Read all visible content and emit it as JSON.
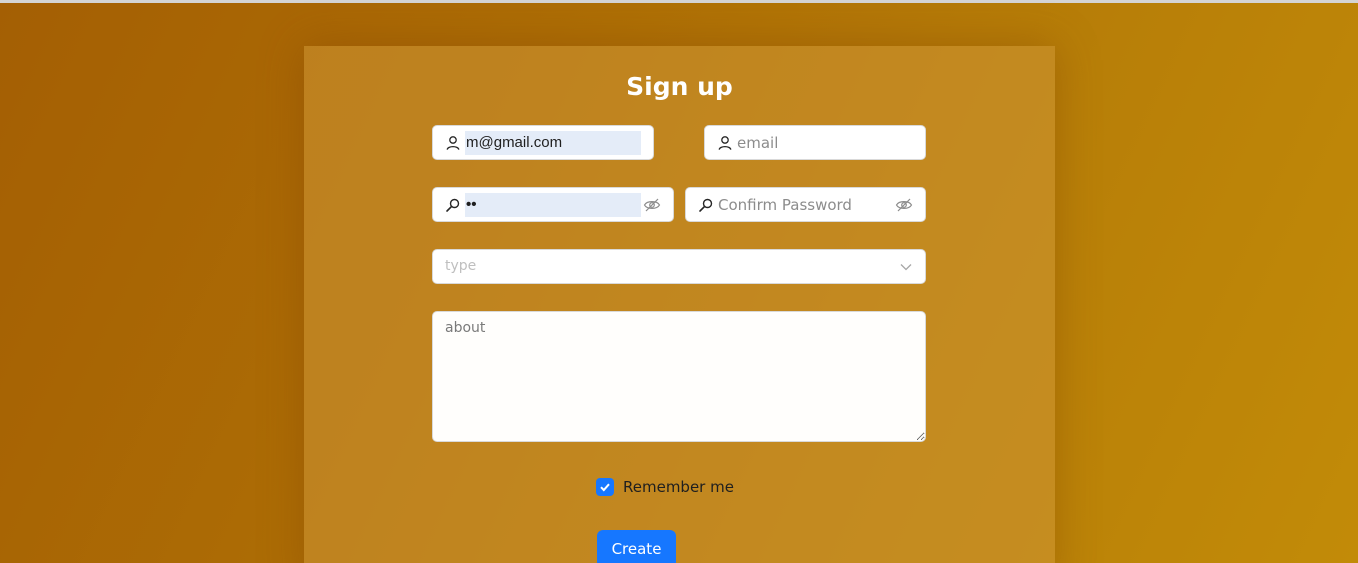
{
  "form": {
    "title": "Sign up",
    "username": {
      "value": "m@gmail.com",
      "icon": "user-icon"
    },
    "email": {
      "placeholder": "email",
      "icon": "user-icon"
    },
    "password": {
      "value": "••",
      "icon": "key-icon",
      "toggle_icon": "eye-invisible-icon"
    },
    "confirm_password": {
      "placeholder": "Confirm Password",
      "icon": "key-icon",
      "toggle_icon": "eye-invisible-icon"
    },
    "type_select": {
      "placeholder": "type",
      "icon": "chevron-down-icon"
    },
    "about": {
      "placeholder": "about"
    },
    "remember": {
      "label": "Remember me",
      "checked": true
    },
    "create_button": {
      "label": "Create"
    }
  },
  "colors": {
    "primary": "#1677ff",
    "background_start": "#a45f04",
    "background_end": "#c28b08",
    "card": "#cd9634"
  }
}
